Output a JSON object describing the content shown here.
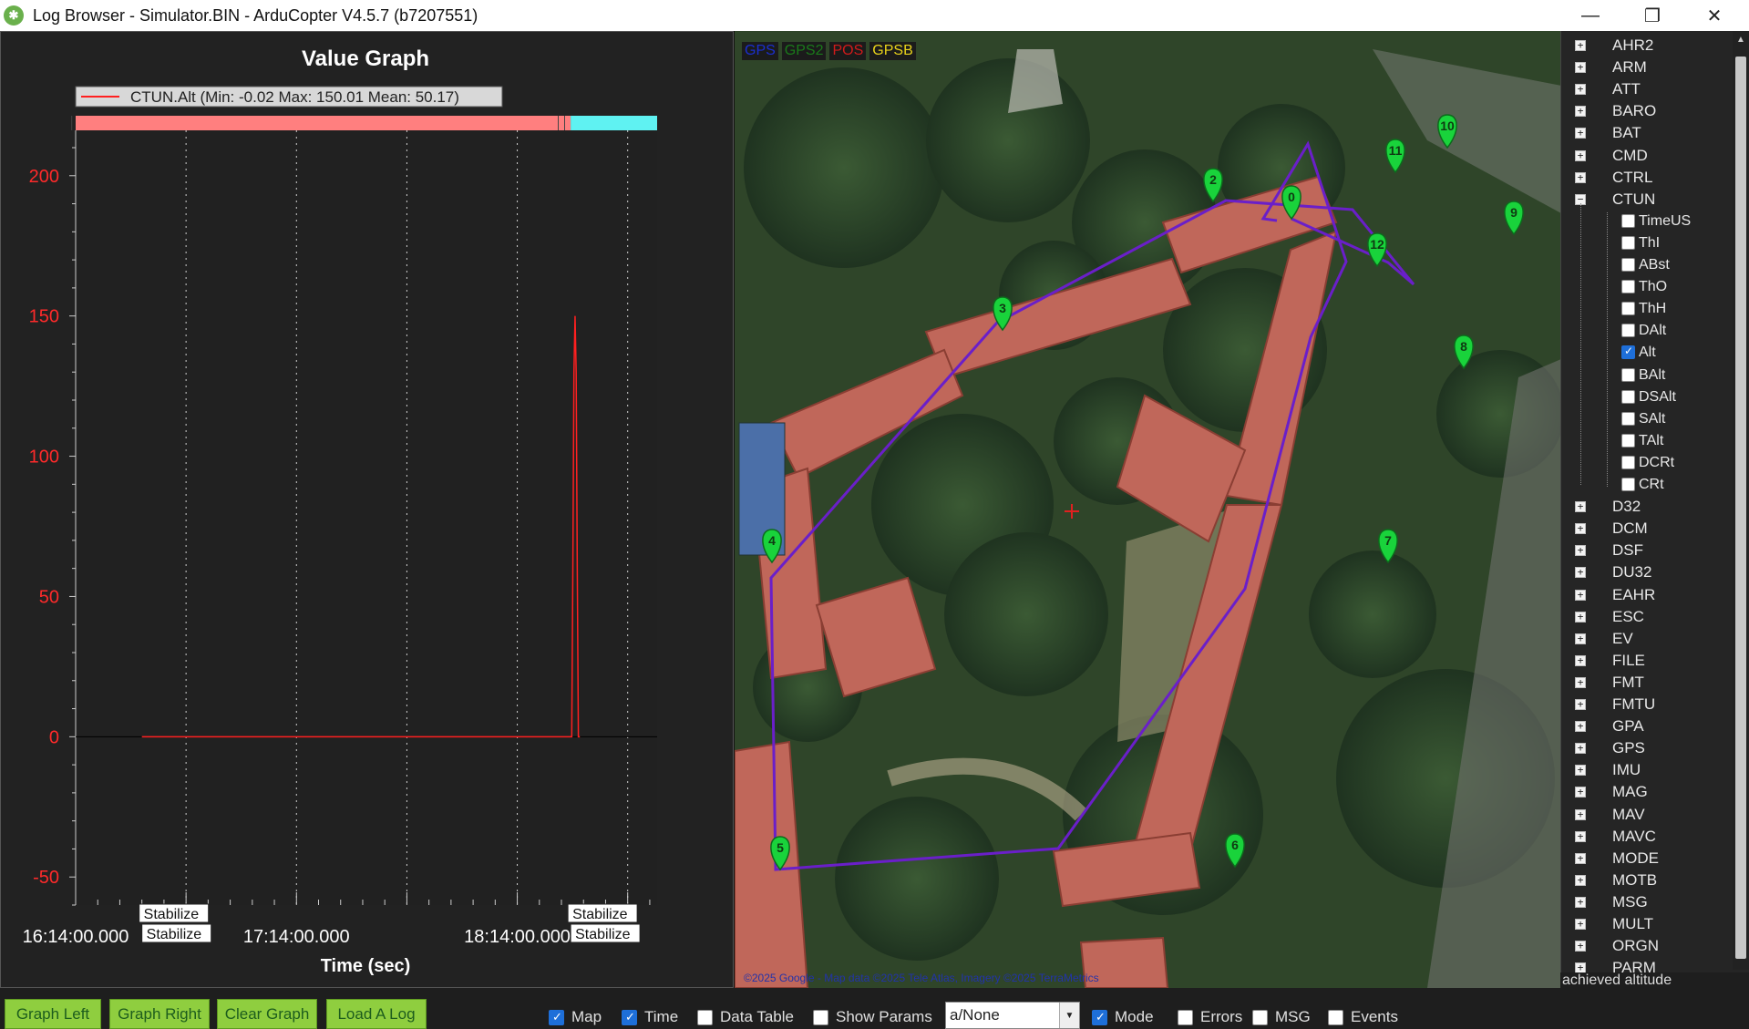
{
  "window": {
    "title": "Log Browser - Simulator.BIN - ArduCopter V4.5.7 (b7207551)",
    "minimize": "—",
    "maximize": "❐",
    "close": "✕"
  },
  "graph": {
    "title": "Value Graph",
    "legend": "CTUN.Alt  (Min: -0.02 Max: 150.01 Mean: 50.17)",
    "xlabel": "Time (sec)",
    "mode_labels": [
      [
        "Stabilize",
        "Stabilize"
      ],
      [
        "Stabilize",
        "Stabilize"
      ]
    ]
  },
  "chart_data": {
    "type": "line",
    "title": "Value Graph",
    "xlabel": "Time (sec)",
    "ylabel": "",
    "x_tick_labels": [
      "16:14:00.000",
      "17:14:00.000",
      "18:14:00.000"
    ],
    "y_ticks": [
      200,
      150,
      100,
      50,
      0,
      -50
    ],
    "ylim": [
      -60,
      210
    ],
    "xlim_minutes": [
      0,
      158
    ],
    "series": [
      {
        "name": "CTUN.Alt",
        "color": "#ff2020",
        "x_minutes": [
          18,
          134.5,
          134.8,
          135.1,
          135.4,
          135.7,
          136.0,
          136.3,
          136.6,
          137.0
        ],
        "values": [
          0,
          0,
          0,
          60,
          130,
          150,
          130,
          60,
          0,
          0
        ]
      }
    ],
    "mode_bar": [
      {
        "start_min": 0,
        "end_min": 134.5,
        "color": "#ff7f7f"
      },
      {
        "start_min": 134.5,
        "end_min": 158,
        "color": "#5ff2f2"
      }
    ],
    "grid": true
  },
  "map": {
    "legend": [
      {
        "label": "GPS",
        "color": "#1b2fd0"
      },
      {
        "label": "GPS2",
        "color": "#1a7a1a"
      },
      {
        "label": "POS",
        "color": "#d01b1b"
      },
      {
        "label": "GPSB",
        "color": "#e8d21b"
      }
    ],
    "copyright": "©2025 Google - Map data ©2025 Tele Atlas, Imagery ©2025 TerraMetrics",
    "waypoints": [
      "0",
      "2",
      "3",
      "4",
      "5",
      "6",
      "7",
      "8",
      "9",
      "10",
      "11",
      "12"
    ]
  },
  "tree": {
    "top_items": [
      "AHR2",
      "ARM",
      "ATT",
      "BARO",
      "BAT",
      "CMD",
      "CTRL",
      "CTUN"
    ],
    "ctun_children": [
      {
        "label": "TimeUS",
        "checked": false
      },
      {
        "label": "ThI",
        "checked": false
      },
      {
        "label": "ABst",
        "checked": false
      },
      {
        "label": "ThO",
        "checked": false
      },
      {
        "label": "ThH",
        "checked": false
      },
      {
        "label": "DAlt",
        "checked": false
      },
      {
        "label": "Alt",
        "checked": true
      },
      {
        "label": "BAlt",
        "checked": false
      },
      {
        "label": "DSAlt",
        "checked": false
      },
      {
        "label": "SAlt",
        "checked": false
      },
      {
        "label": "TAlt",
        "checked": false
      },
      {
        "label": "DCRt",
        "checked": false
      },
      {
        "label": "CRt",
        "checked": false
      }
    ],
    "bottom_items": [
      "D32",
      "DCM",
      "DSF",
      "DU32",
      "EAHR",
      "ESC",
      "EV",
      "FILE",
      "FMT",
      "FMTU",
      "GPA",
      "GPS",
      "IMU",
      "MAG",
      "MAV",
      "MAVC",
      "MODE",
      "MOTB",
      "MSG",
      "MULT",
      "ORGN",
      "PARM"
    ],
    "status": "achieved altitude"
  },
  "toolbar": {
    "buttons": [
      "Graph Left",
      "Graph Right",
      "Clear Graph",
      "Load A Log"
    ],
    "checks": [
      {
        "label": "Map",
        "checked": true
      },
      {
        "label": "Time",
        "checked": true
      },
      {
        "label": "Data Table",
        "checked": false
      },
      {
        "label": "Show Params",
        "checked": false
      }
    ],
    "combo_value": "a/None",
    "checks2": [
      {
        "label": "Mode",
        "checked": true
      },
      {
        "label": "Errors",
        "checked": false
      },
      {
        "label": "MSG",
        "checked": false
      },
      {
        "label": "Events",
        "checked": false
      }
    ]
  }
}
